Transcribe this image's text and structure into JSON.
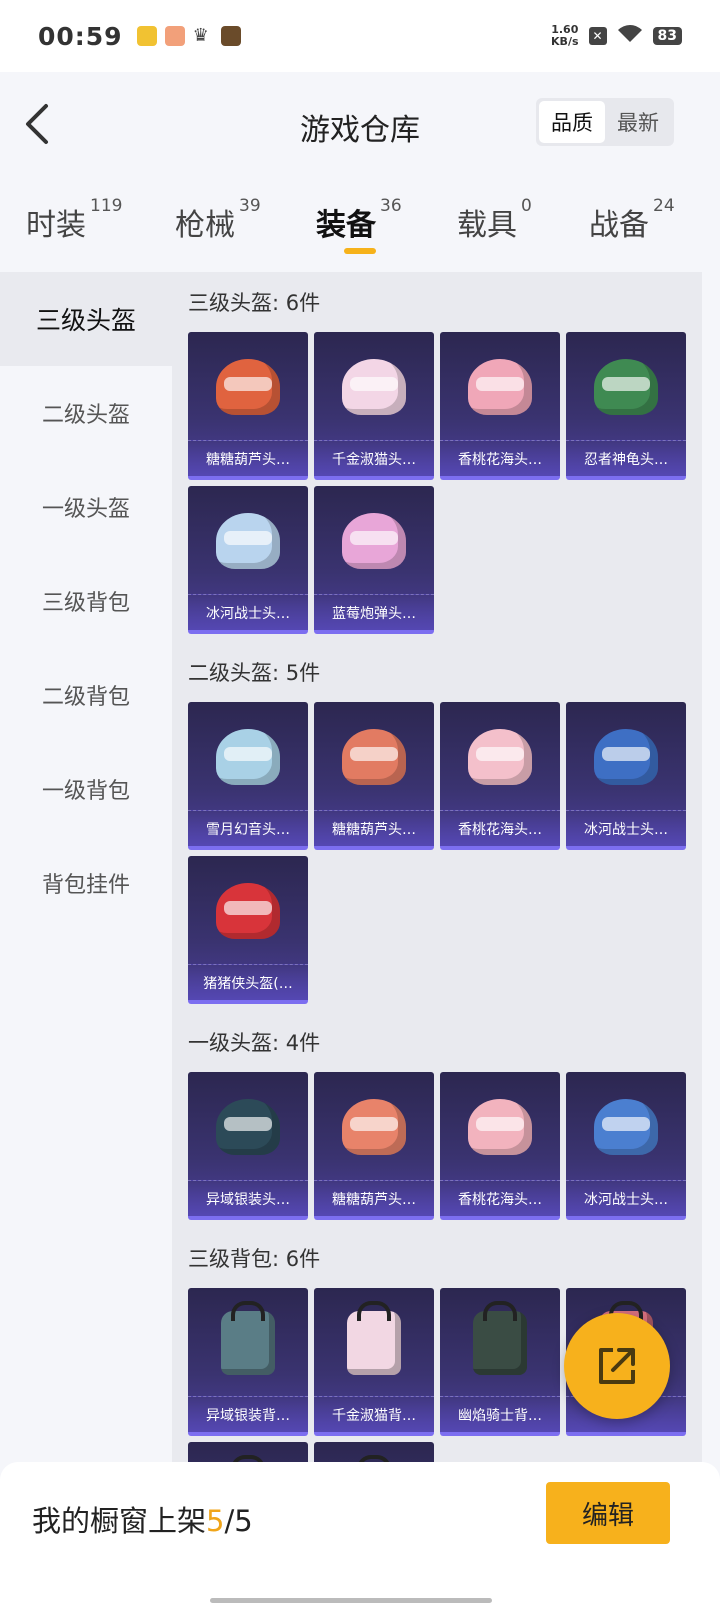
{
  "status_bar": {
    "time": "00:59",
    "speed_value": "1.60",
    "speed_unit": "KB/s",
    "battery": "83"
  },
  "header": {
    "title": "游戏仓库",
    "sort_options": [
      {
        "label": "品质",
        "active": true
      },
      {
        "label": "最新",
        "active": false
      }
    ]
  },
  "tabs": [
    {
      "label": "时装",
      "count": "119",
      "active": false
    },
    {
      "label": "枪械",
      "count": "39",
      "active": false
    },
    {
      "label": "装备",
      "count": "36",
      "active": true
    },
    {
      "label": "载具",
      "count": "0",
      "active": false
    },
    {
      "label": "战备",
      "count": "24",
      "active": false
    }
  ],
  "sidebar": {
    "items": [
      {
        "label": "三级头盔",
        "active": true
      },
      {
        "label": "二级头盔",
        "active": false
      },
      {
        "label": "一级头盔",
        "active": false
      },
      {
        "label": "三级背包",
        "active": false
      },
      {
        "label": "二级背包",
        "active": false
      },
      {
        "label": "一级背包",
        "active": false
      },
      {
        "label": "背包挂件",
        "active": false
      }
    ]
  },
  "sections": [
    {
      "title": "三级头盔: 6件",
      "items": [
        {
          "name": "糖糖葫芦头…",
          "kind": "helmet",
          "color": "#e0633f"
        },
        {
          "name": "千金淑猫头…",
          "kind": "helmet",
          "color": "#f3d6e6"
        },
        {
          "name": "香桃花海头…",
          "kind": "helmet",
          "color": "#f0a7b8"
        },
        {
          "name": "忍者神龟头…",
          "kind": "helmet",
          "color": "#3f8a52"
        },
        {
          "name": "冰河战士头…",
          "kind": "helmet",
          "color": "#b9d4ee"
        },
        {
          "name": "蓝莓炮弹头…",
          "kind": "helmet",
          "color": "#e8a6d8"
        }
      ]
    },
    {
      "title": "二级头盔: 5件",
      "items": [
        {
          "name": "雪月幻音头…",
          "kind": "helmet",
          "color": "#a9d1e6"
        },
        {
          "name": "糖糖葫芦头…",
          "kind": "helmet",
          "color": "#e27b62"
        },
        {
          "name": "香桃花海头…",
          "kind": "helmet",
          "color": "#f4c0cb"
        },
        {
          "name": "冰河战士头…",
          "kind": "helmet",
          "color": "#3e6fc4"
        },
        {
          "name": "猪猪侠头盔(…",
          "kind": "helmet",
          "color": "#d8343a"
        }
      ]
    },
    {
      "title": "一级头盔: 4件",
      "items": [
        {
          "name": "异域银装头…",
          "kind": "helmet",
          "color": "#2c4a58"
        },
        {
          "name": "糖糖葫芦头…",
          "kind": "helmet",
          "color": "#e8836a"
        },
        {
          "name": "香桃花海头…",
          "kind": "helmet",
          "color": "#f2b3be"
        },
        {
          "name": "冰河战士头…",
          "kind": "helmet",
          "color": "#4b7fd0"
        }
      ]
    },
    {
      "title": "三级背包: 6件",
      "items": [
        {
          "name": "异域银装背…",
          "kind": "pack",
          "color": "#5a7d86"
        },
        {
          "name": "千金淑猫背…",
          "kind": "pack",
          "color": "#f2d7e3"
        },
        {
          "name": "幽焰骑士背…",
          "kind": "pack",
          "color": "#3a4c44"
        },
        {
          "name": "",
          "kind": "pack",
          "color": "#d46e7c"
        },
        {
          "name": "",
          "kind": "pack",
          "color": "#3a3f58"
        },
        {
          "name": "",
          "kind": "pack",
          "color": "#4466aa"
        }
      ]
    }
  ],
  "bottom_bar": {
    "showcase_label": "我的橱窗上架",
    "current": "5",
    "separator": "/",
    "total": "5",
    "edit_label": "编辑"
  }
}
